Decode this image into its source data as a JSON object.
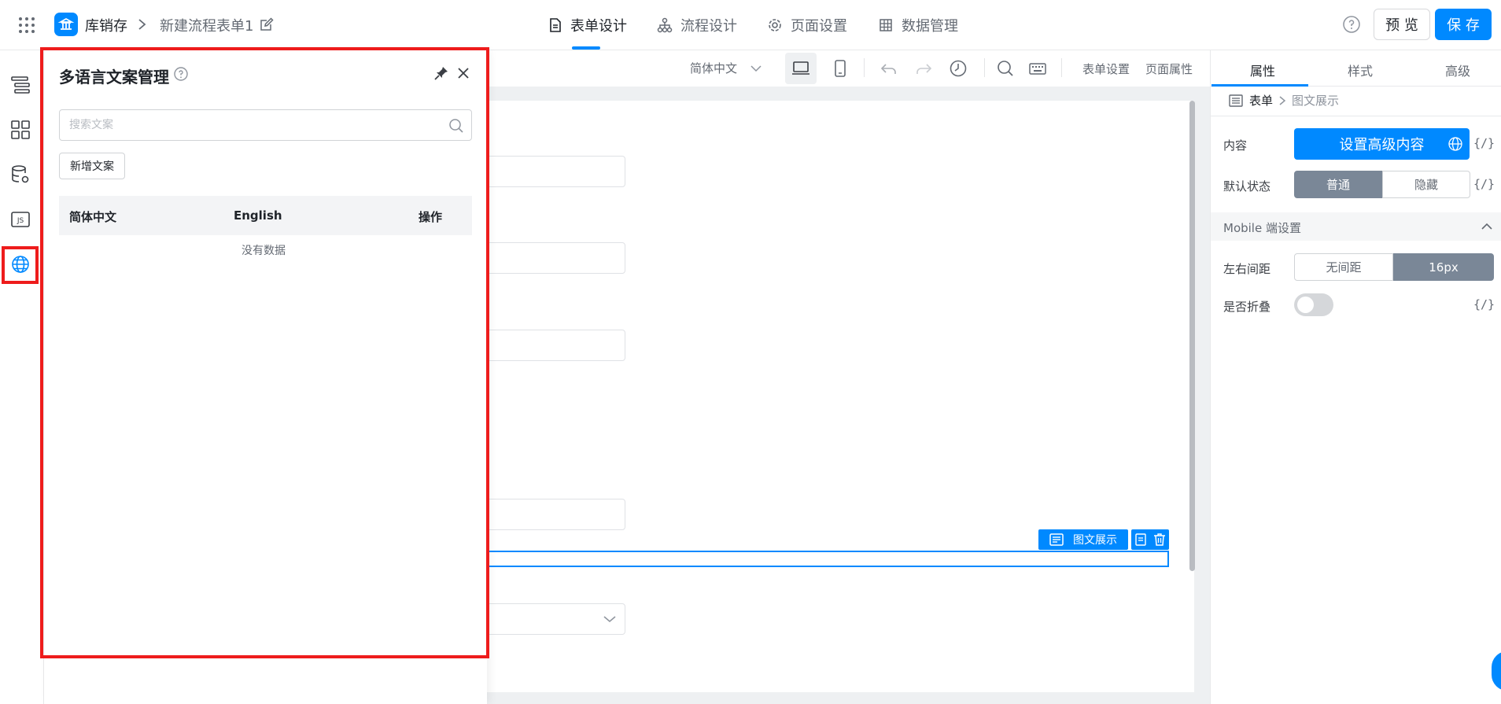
{
  "header": {
    "app_name": "库销存",
    "form_name": "新建流程表单1",
    "tabs": [
      {
        "label": "表单设计",
        "icon": "document-icon"
      },
      {
        "label": "流程设计",
        "icon": "flow-icon"
      },
      {
        "label": "页面设置",
        "icon": "gear-icon"
      },
      {
        "label": "数据管理",
        "icon": "grid-icon"
      }
    ],
    "preview_label": "预 览",
    "save_label": "保 存"
  },
  "rail": {
    "items": [
      "outline-icon",
      "components-icon",
      "datasource-icon",
      "js-icon",
      "globe-icon"
    ],
    "js_label": "JS"
  },
  "toolbar": {
    "language": "简体中文",
    "form_settings": "表单设置",
    "page_properties": "页面属性"
  },
  "canvas": {
    "selected_component_label": "图文展示"
  },
  "i18n_panel": {
    "title": "多语言文案管理",
    "search_placeholder": "搜索文案",
    "add_button": "新增文案",
    "columns": [
      "简体中文",
      "English",
      "操作"
    ],
    "empty_text": "没有数据"
  },
  "props": {
    "tabs": [
      "属性",
      "样式",
      "高级"
    ],
    "breadcrumb": [
      "表单",
      "图文展示"
    ],
    "content_label": "内容",
    "content_button": "设置高级内容",
    "default_state_label": "默认状态",
    "default_state_options": [
      "普通",
      "隐藏"
    ],
    "mobile_section": "Mobile 端设置",
    "spacing_label": "左右间距",
    "spacing_options": [
      "无间距",
      "16px"
    ],
    "collapse_label": "是否折叠",
    "expr_symbol": "{/}"
  },
  "colors": {
    "accent": "#0089ff",
    "highlight": "#ee1c1c",
    "segment_active": "#7a8797"
  }
}
